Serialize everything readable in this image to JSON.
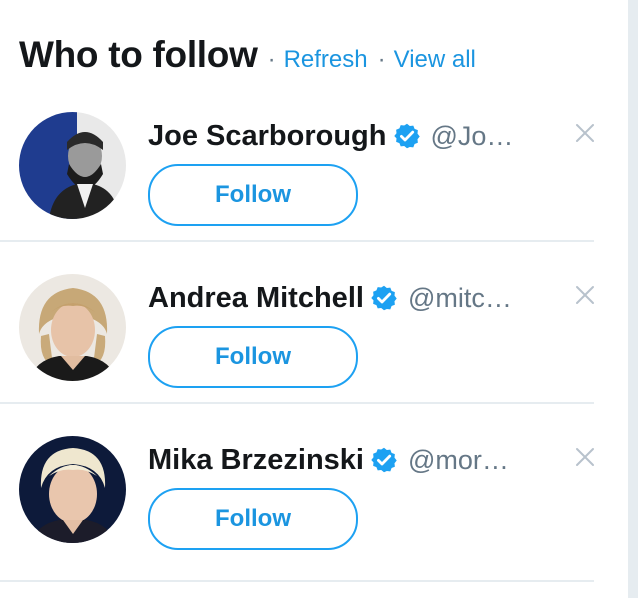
{
  "module": {
    "title": "Who to follow",
    "separator": "·",
    "refresh_label": "Refresh",
    "view_all_label": "View all"
  },
  "colors": {
    "link": "#1b95e0",
    "text_primary": "#14171a",
    "text_secondary": "#657786",
    "divider": "#e6ecf0",
    "verified": "#1da1f2"
  },
  "suggestions": [
    {
      "full_name": "Joe Scarborough",
      "screen_name": "@Jo…",
      "verified": true,
      "follow_label": "Follow",
      "avatar_icon": "portrait-avatar",
      "dismiss_icon": "close-icon"
    },
    {
      "full_name": "Andrea Mitchell",
      "screen_name": "@mitc…",
      "verified": true,
      "follow_label": "Follow",
      "avatar_icon": "portrait-avatar",
      "dismiss_icon": "close-icon"
    },
    {
      "full_name": "Mika Brzezinski",
      "screen_name": "@mor…",
      "verified": true,
      "follow_label": "Follow",
      "avatar_icon": "portrait-avatar",
      "dismiss_icon": "close-icon"
    }
  ]
}
